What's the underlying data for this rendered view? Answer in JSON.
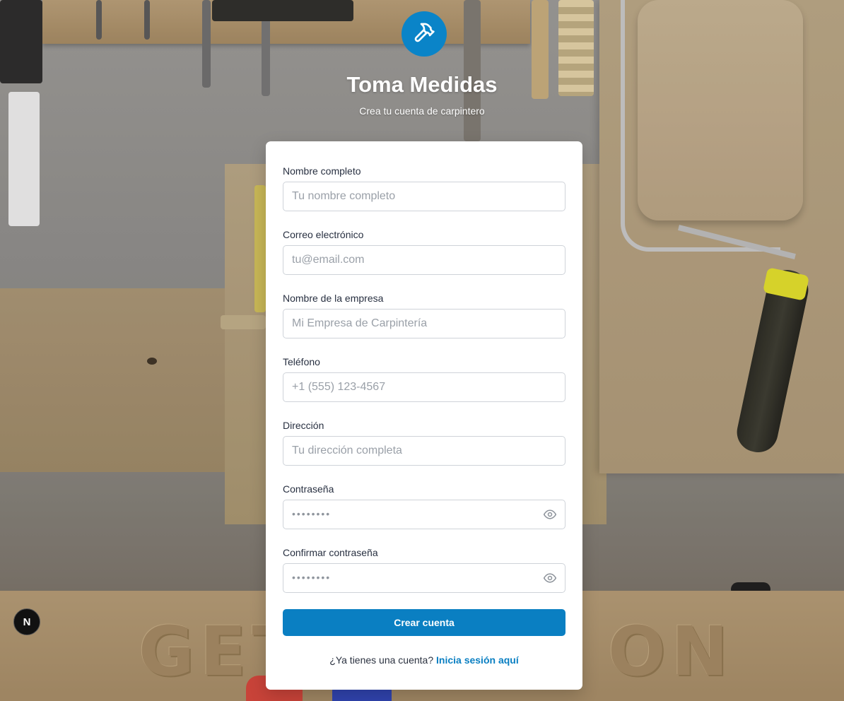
{
  "header": {
    "title": "Toma Medidas",
    "subtitle": "Crea tu cuenta de carpintero",
    "logo_icon": "hammer-icon"
  },
  "form": {
    "fields": [
      {
        "label": "Nombre completo",
        "placeholder": "Tu nombre completo",
        "type": "text"
      },
      {
        "label": "Correo electrónico",
        "placeholder": "tu@email.com",
        "type": "email"
      },
      {
        "label": "Nombre de la empresa",
        "placeholder": "Mi Empresa de Carpintería",
        "type": "text"
      },
      {
        "label": "Teléfono",
        "placeholder": "+1 (555) 123-4567",
        "type": "tel"
      },
      {
        "label": "Dirección",
        "placeholder": "Tu dirección completa",
        "type": "text"
      },
      {
        "label": "Contraseña",
        "placeholder": "••••••••",
        "type": "password"
      },
      {
        "label": "Confirmar contraseña",
        "placeholder": "••••••••",
        "type": "password"
      }
    ],
    "submit_label": "Crear cuenta",
    "footer_text": "¿Ya tienes una cuenta?",
    "footer_link": "Inicia sesión aquí"
  },
  "badge": {
    "label": "N"
  },
  "background": {
    "engraved_left": "GET",
    "engraved_right": "ON"
  },
  "colors": {
    "accent": "#0a7fc2",
    "logo_bg": "#0a84c8",
    "card_bg": "#ffffff"
  }
}
